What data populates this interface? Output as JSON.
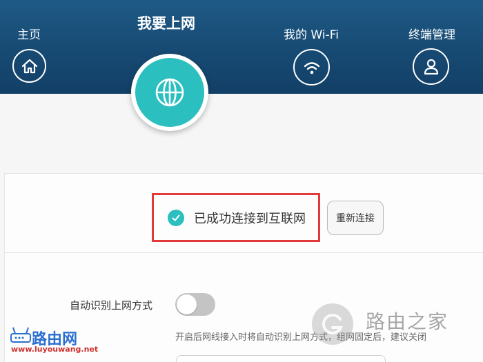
{
  "nav": {
    "home_label": "主页",
    "internet_label": "我要上网",
    "wifi_label": "我的 Wi-Fi",
    "terminal_label": "终端管理"
  },
  "status": {
    "connected_text": "已成功连接到互联网",
    "reconnect_label": "重新连接"
  },
  "auto_detect": {
    "label": "自动识别上网方式",
    "enabled": false,
    "hint": "开启后网线接入时将自动识别上网方式，组网固定后，建议关闭"
  },
  "watermarks": {
    "left_logo_text": "路由网",
    "left_url": "www.luyouwang.net",
    "right_text": "路由之家"
  },
  "colors": {
    "header_blue": "#1a4f7a",
    "accent_teal": "#2cbfbf",
    "highlight_red": "#e23a3a",
    "toggle_off": "#c4c4c4"
  },
  "icons": {
    "home": "home-icon",
    "internet": "globe-icon",
    "wifi": "wifi-icon",
    "terminal": "user-icon",
    "status": "checkmark-icon"
  }
}
